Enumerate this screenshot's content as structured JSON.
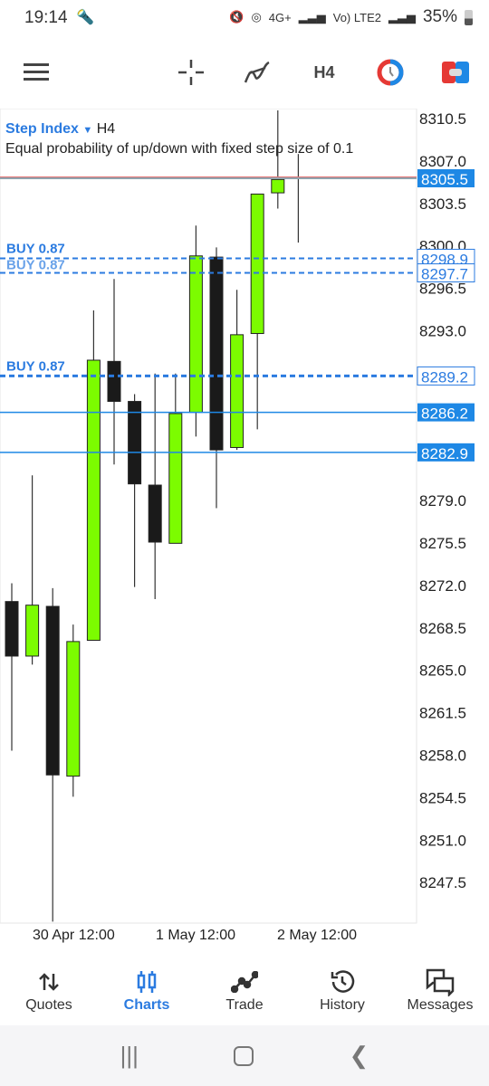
{
  "status_bar": {
    "time": "19:14",
    "battery": "35%",
    "network1": "4G+",
    "network2": "Vo) LTE2"
  },
  "toolbar": {
    "timeframe": "H4"
  },
  "chart": {
    "symbol": "Step Index",
    "timeframe": "H4",
    "description": "Equal probability of up/down with fixed step size of 0.1"
  },
  "chart_data": {
    "type": "candlestick",
    "y_ticks": [
      "8310.5",
      "8307.0",
      "8303.5",
      "8300.0",
      "8296.5",
      "8293.0",
      "8279.0",
      "8275.5",
      "8272.0",
      "8268.5",
      "8265.0",
      "8261.5",
      "8258.0",
      "8254.5",
      "8251.0",
      "8247.5"
    ],
    "x_ticks": [
      "30 Apr 12:00",
      "1 May 12:00",
      "2 May 12:00"
    ],
    "ylim": [
      8243,
      8313
    ],
    "candles": [
      {
        "o": 8270.6,
        "h": 8272.1,
        "l": 8258.3,
        "c": 8266.1
      },
      {
        "o": 8266.1,
        "h": 8281.0,
        "l": 8265.4,
        "c": 8270.3
      },
      {
        "o": 8270.2,
        "h": 8271.7,
        "l": 8244.2,
        "c": 8256.3
      },
      {
        "o": 8256.2,
        "h": 8268.7,
        "l": 8254.5,
        "c": 8267.3
      },
      {
        "o": 8267.4,
        "h": 8294.6,
        "l": 8267.4,
        "c": 8290.5
      },
      {
        "o": 8290.4,
        "h": 8297.2,
        "l": 8281.9,
        "c": 8287.1
      },
      {
        "o": 8287.1,
        "h": 8287.7,
        "l": 8271.8,
        "c": 8280.3
      },
      {
        "o": 8280.2,
        "h": 8289.4,
        "l": 8270.8,
        "c": 8275.5
      },
      {
        "o": 8275.4,
        "h": 8289.4,
        "l": 8275.4,
        "c": 8286.1
      },
      {
        "o": 8286.2,
        "h": 8301.6,
        "l": 8284.2,
        "c": 8299.1
      },
      {
        "o": 8299.0,
        "h": 8299.8,
        "l": 8278.3,
        "c": 8283.1
      },
      {
        "o": 8283.3,
        "h": 8296.3,
        "l": 8283.1,
        "c": 8292.6
      },
      {
        "o": 8292.7,
        "h": 8304.2,
        "l": 8284.8,
        "c": 8304.2
      },
      {
        "o": 8304.3,
        "h": 8311.1,
        "l": 8303.0,
        "c": 8305.4
      },
      {
        "o": 8305.5,
        "h": 8307.5,
        "l": 8300.2,
        "c": 8305.6
      }
    ],
    "bull_color": "#7cfc00",
    "bear_color": "#1a1a1a",
    "price_lines": [
      {
        "price": "8305.5",
        "kind": "bid",
        "color": "#1e88e5"
      },
      {
        "price": "8298.9",
        "kind": "order",
        "label": "BUY 0.87",
        "color": "#2b7be0"
      },
      {
        "price": "8297.7",
        "kind": "order",
        "label": "BUY 0.87",
        "color": "#2b7be0"
      },
      {
        "price": "8289.2",
        "kind": "order",
        "label": "BUY 0.87",
        "color": "#2b7be0"
      },
      {
        "price": "8286.2",
        "kind": "level",
        "color": "#1e88e5"
      },
      {
        "price": "8282.9",
        "kind": "level",
        "color": "#1e88e5"
      }
    ]
  },
  "nav": [
    {
      "label": "Quotes",
      "icon": "arrows-up-down-icon"
    },
    {
      "label": "Charts",
      "icon": "candles-icon",
      "active": true
    },
    {
      "label": "Trade",
      "icon": "trade-line-icon"
    },
    {
      "label": "History",
      "icon": "history-icon"
    },
    {
      "label": "Messages",
      "icon": "messages-icon"
    }
  ]
}
